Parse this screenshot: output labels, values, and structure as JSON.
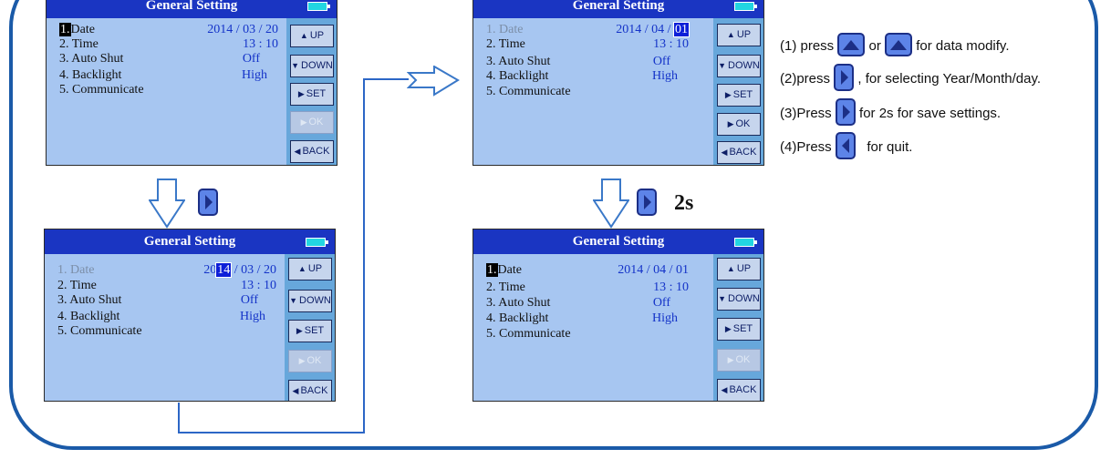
{
  "screen": {
    "title": "General Setting",
    "items": [
      {
        "num": "1.",
        "label": "Date"
      },
      {
        "num": "2.",
        "label": "Time"
      },
      {
        "num": "3.",
        "label": "Auto Shut"
      },
      {
        "num": "4.",
        "label": "Backlight"
      },
      {
        "num": "5.",
        "label": "Communicate"
      }
    ],
    "values": {
      "time": "13 : 10",
      "auto_shut": "Off",
      "backlight": "High"
    },
    "buttons": {
      "up": "UP",
      "down": "DOWN",
      "set": "SET",
      "ok": "OK",
      "back": "BACK"
    }
  },
  "screens": {
    "a": {
      "date": "2014 / 03 / 20"
    },
    "b": {
      "date_pre": "20",
      "date_hl": "14",
      "date_post": "/ 03 / 20"
    },
    "c": {
      "date_pre": "2014 / 04 / ",
      "date_hl": "01"
    },
    "d": {
      "date": "2014 / 04 / 01"
    }
  },
  "annotation": {
    "hold_time": "2s"
  },
  "instructions": {
    "step1_a": "(1) press",
    "step1_b": "or",
    "step1_c": "for data modify.",
    "step2_a": "(2)press",
    "step2_b": ", for selecting Year/Month/day.",
    "step3_a": "(3)Press",
    "step3_b": "for 2s for save settings.",
    "step4_a": "(4)Press",
    "step4_b": "for quit."
  },
  "icons": {
    "up": "up-triangle-icon",
    "right": "right-triangle-icon",
    "left": "left-triangle-icon"
  },
  "colors": {
    "frame": "#1a5aa8",
    "titlebar": "#1a35c2",
    "screen_bg": "#a7c6f1",
    "value_text": "#1433c8"
  }
}
